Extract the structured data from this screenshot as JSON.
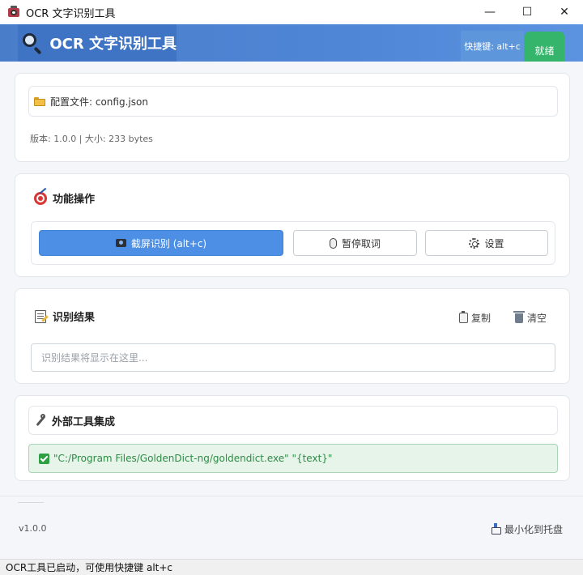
{
  "window": {
    "title": "OCR 文字识别工具",
    "controls": [
      "—",
      "☐",
      "✕"
    ]
  },
  "header": {
    "title": "OCR 文字识别工具",
    "shortcut_hint": "快捷键: alt+c",
    "status": "就绪"
  },
  "config": {
    "file_label": "配置文件: config.json",
    "version_info": "版本: 1.0.0 | 大小: 233 bytes"
  },
  "operations": {
    "title": "功能操作",
    "capture_label": "截屏识别 (alt+c)",
    "pause_label": "暂停取词",
    "settings_label": "设置"
  },
  "result": {
    "title": "识别结果",
    "copy_label": "复制",
    "clear_label": "清空",
    "placeholder": "识别结果将显示在这里..."
  },
  "external": {
    "title": "外部工具集成",
    "command": "\"C:/Program Files/GoldenDict-ng/goldendict.exe\" \"{text}\""
  },
  "footer": {
    "version": "v1.0.0",
    "tray_label": "最小化到托盘"
  },
  "statusbar": {
    "message": "OCR工具已启动，可使用快捷键 alt+c"
  },
  "colors": {
    "header": "#4f86d6",
    "primary": "#4c8fe4",
    "ready": "#35b56b",
    "ext_bg": "#e6f4ea",
    "ext_text": "#2e8b45"
  }
}
